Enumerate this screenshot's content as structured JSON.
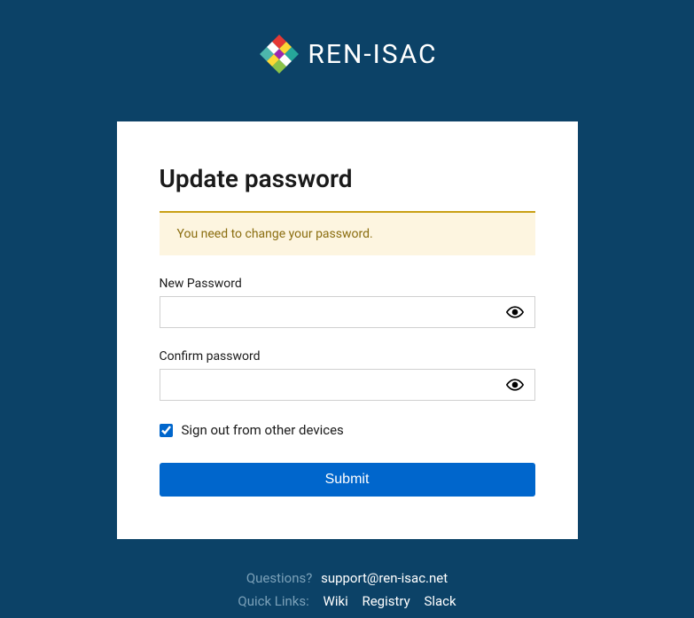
{
  "logo": {
    "text": "REN-ISAC"
  },
  "card": {
    "title": "Update password",
    "alert": "You need to change your password.",
    "fields": {
      "new_password": {
        "label": "New Password",
        "value": ""
      },
      "confirm_password": {
        "label": "Confirm password",
        "value": ""
      }
    },
    "checkbox": {
      "label": "Sign out from other devices",
      "checked": true
    },
    "submit": "Submit"
  },
  "footer": {
    "questions_label": "Questions?",
    "support_email": "support@ren-isac.net",
    "quicklinks_label": "Quick Links:",
    "links": {
      "wiki": "Wiki",
      "registry": "Registry",
      "slack": "Slack"
    }
  }
}
